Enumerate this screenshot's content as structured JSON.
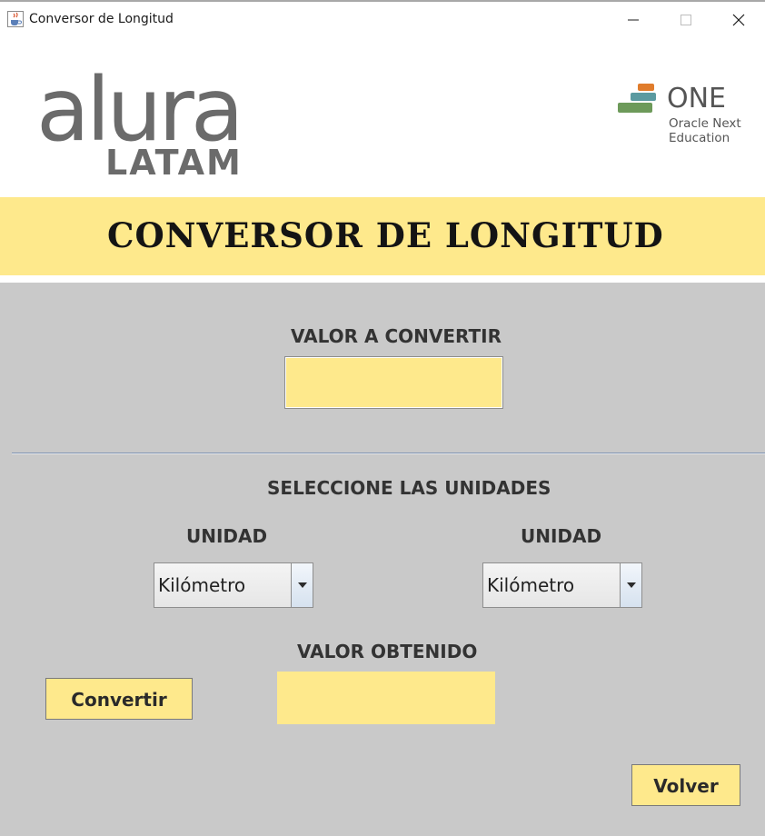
{
  "window": {
    "title": "Conversor de Longitud",
    "app_icon": "java-cup-icon",
    "controls": {
      "minimize": "minimize-icon",
      "maximize": "maximize-icon",
      "close": "close-icon"
    }
  },
  "header": {
    "left_logo": {
      "name": "alura",
      "subtitle": "LATAM"
    },
    "right_logo": {
      "name": "ONE",
      "line1": "Oracle Next",
      "line2": "Education"
    }
  },
  "banner": {
    "title": "CONVERSOR DE LONGITUD"
  },
  "form": {
    "input_label": "VALOR A CONVERTIR",
    "input_value": "",
    "units_heading": "SELECCIONE LAS UNIDADES",
    "unit_from_label": "UNIDAD",
    "unit_from_selected": "Kilómetro",
    "unit_to_label": "UNIDAD",
    "unit_to_selected": "Kilómetro",
    "result_label": "VALOR OBTENIDO",
    "result_value": "",
    "convert_button": "Convertir",
    "back_button": "Volver"
  },
  "colors": {
    "accent_yellow": "#fee98c",
    "panel_gray": "#c9c9c9",
    "logo_gray": "#6b6b6b",
    "one_orange": "#e07c2c",
    "one_teal": "#5b9aa0",
    "one_green": "#6d9a5a"
  }
}
